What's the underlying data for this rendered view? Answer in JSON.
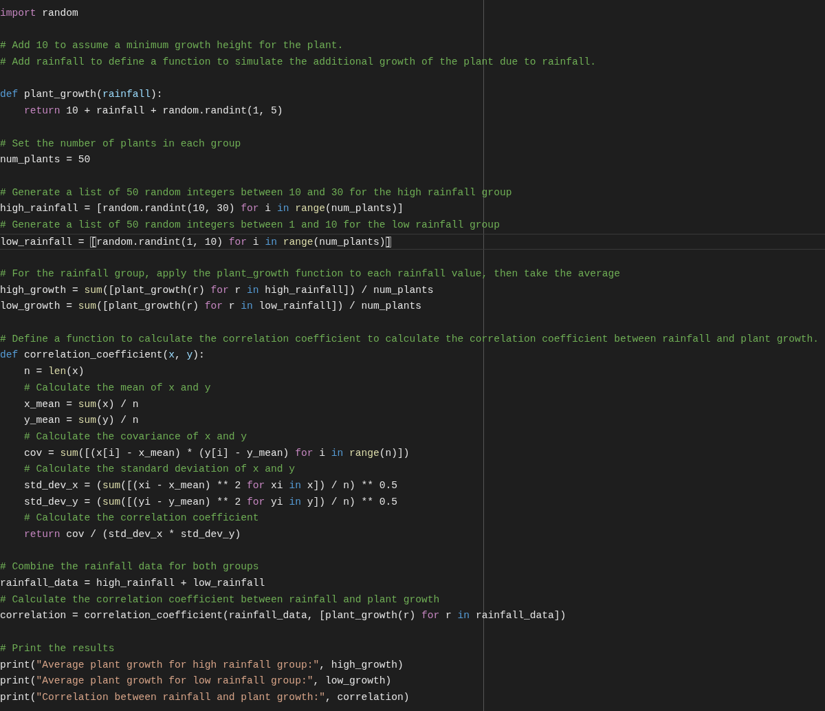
{
  "editor": {
    "lines": [
      {
        "tokens": [
          {
            "kind": "keyword",
            "text": "import"
          },
          {
            "kind": "plain",
            "text": " random"
          }
        ]
      },
      {
        "gap_before": true,
        "tokens": [
          {
            "kind": "comment",
            "text": "# Add 10 to assume a minimum growth height for the plant."
          }
        ]
      },
      {
        "tokens": [
          {
            "kind": "comment",
            "text": "# Add rainfall to define a function to simulate the additional growth of the plant due to rainfall."
          }
        ]
      },
      {
        "gap_before": true,
        "tokens": [
          {
            "kind": "storage",
            "text": "def"
          },
          {
            "kind": "plain",
            "text": " plant_growth("
          },
          {
            "kind": "param",
            "text": "rainfall"
          },
          {
            "kind": "plain",
            "text": "):"
          }
        ]
      },
      {
        "indented": true,
        "tokens": [
          {
            "kind": "keyword",
            "text": "return"
          },
          {
            "kind": "plain",
            "text": " 10 + rainfall + random.randint(1, 5)"
          }
        ]
      },
      {
        "gap_before": true,
        "tokens": [
          {
            "kind": "comment",
            "text": "# Set the number of plants in each group"
          }
        ]
      },
      {
        "tokens": [
          {
            "kind": "plain",
            "text": "num_plants = 50"
          }
        ]
      },
      {
        "gap_before": true,
        "tokens": [
          {
            "kind": "comment",
            "text": "# Generate a list of 50 random integers between 10 and 30 for the high rainfall group"
          }
        ]
      },
      {
        "tokens": [
          {
            "kind": "plain",
            "text": "high_rainfall = [random.randint(10, 30) "
          },
          {
            "kind": "keyword",
            "text": "for"
          },
          {
            "kind": "plain",
            "text": " i "
          },
          {
            "kind": "storage",
            "text": "in"
          },
          {
            "kind": "builtin",
            "text": " range"
          },
          {
            "kind": "plain",
            "text": "(num_plants)]"
          }
        ]
      },
      {
        "tokens": [
          {
            "kind": "comment",
            "text": "# Generate a list of 50 random integers between 1 and 10 for the low rainfall group"
          }
        ]
      },
      {
        "current": true,
        "tokens": [
          {
            "kind": "plain",
            "text": "low_rainfall = "
          },
          {
            "kind": "bracket",
            "text": "["
          },
          {
            "kind": "plain",
            "text": "random.randint(1, 10) "
          },
          {
            "kind": "keyword",
            "text": "for"
          },
          {
            "kind": "plain",
            "text": " i "
          },
          {
            "kind": "storage",
            "text": "in"
          },
          {
            "kind": "builtin",
            "text": " range"
          },
          {
            "kind": "plain",
            "text": "(num_plants)"
          },
          {
            "kind": "bracket",
            "text": "]"
          }
        ]
      },
      {
        "gap_before": true,
        "tokens": [
          {
            "kind": "comment",
            "text": "# For the rainfall group, apply the plant_growth function to each rainfall value, then take the average"
          }
        ]
      },
      {
        "tokens": [
          {
            "kind": "plain",
            "text": "high_growth = "
          },
          {
            "kind": "builtin",
            "text": "sum"
          },
          {
            "kind": "plain",
            "text": "([plant_growth(r) "
          },
          {
            "kind": "keyword",
            "text": "for"
          },
          {
            "kind": "plain",
            "text": " r "
          },
          {
            "kind": "storage",
            "text": "in"
          },
          {
            "kind": "plain",
            "text": " high_rainfall]) / num_plants"
          }
        ]
      },
      {
        "tokens": [
          {
            "kind": "plain",
            "text": "low_growth = "
          },
          {
            "kind": "builtin",
            "text": "sum"
          },
          {
            "kind": "plain",
            "text": "([plant_growth(r) "
          },
          {
            "kind": "keyword",
            "text": "for"
          },
          {
            "kind": "plain",
            "text": " r "
          },
          {
            "kind": "storage",
            "text": "in"
          },
          {
            "kind": "plain",
            "text": " low_rainfall]) / num_plants"
          }
        ]
      },
      {
        "gap_before": true,
        "tokens": [
          {
            "kind": "comment",
            "text": "# Define a function to calculate the correlation coefficient to calculate the correlation coefficient between rainfall and plant growth."
          }
        ]
      },
      {
        "tokens": [
          {
            "kind": "storage",
            "text": "def"
          },
          {
            "kind": "plain",
            "text": " correlation_coefficient("
          },
          {
            "kind": "param",
            "text": "x"
          },
          {
            "kind": "plain",
            "text": ", "
          },
          {
            "kind": "param",
            "text": "y"
          },
          {
            "kind": "plain",
            "text": "):"
          }
        ]
      },
      {
        "indented": true,
        "tokens": [
          {
            "kind": "plain",
            "text": "n = "
          },
          {
            "kind": "builtin",
            "text": "len"
          },
          {
            "kind": "plain",
            "text": "(x)"
          }
        ]
      },
      {
        "indented": true,
        "tokens": [
          {
            "kind": "comment",
            "text": "# Calculate the mean of x and y"
          }
        ]
      },
      {
        "indented": true,
        "tokens": [
          {
            "kind": "plain",
            "text": "x_mean = "
          },
          {
            "kind": "builtin",
            "text": "sum"
          },
          {
            "kind": "plain",
            "text": "(x) / n"
          }
        ]
      },
      {
        "indented": true,
        "tokens": [
          {
            "kind": "plain",
            "text": "y_mean = "
          },
          {
            "kind": "builtin",
            "text": "sum"
          },
          {
            "kind": "plain",
            "text": "(y) / n"
          }
        ]
      },
      {
        "indented": true,
        "tokens": [
          {
            "kind": "comment",
            "text": "# Calculate the covariance of x and y"
          }
        ]
      },
      {
        "indented": true,
        "tokens": [
          {
            "kind": "plain",
            "text": "cov = "
          },
          {
            "kind": "builtin",
            "text": "sum"
          },
          {
            "kind": "plain",
            "text": "([(x[i] - x_mean) * (y[i] - y_mean) "
          },
          {
            "kind": "keyword",
            "text": "for"
          },
          {
            "kind": "plain",
            "text": " i "
          },
          {
            "kind": "storage",
            "text": "in"
          },
          {
            "kind": "builtin",
            "text": " range"
          },
          {
            "kind": "plain",
            "text": "(n)])"
          }
        ]
      },
      {
        "indented": true,
        "tokens": [
          {
            "kind": "comment",
            "text": "# Calculate the standard deviation of x and y"
          }
        ]
      },
      {
        "indented": true,
        "tokens": [
          {
            "kind": "plain",
            "text": "std_dev_x = ("
          },
          {
            "kind": "builtin",
            "text": "sum"
          },
          {
            "kind": "plain",
            "text": "([(xi - x_mean) ** 2 "
          },
          {
            "kind": "keyword",
            "text": "for"
          },
          {
            "kind": "plain",
            "text": " xi "
          },
          {
            "kind": "storage",
            "text": "in"
          },
          {
            "kind": "plain",
            "text": " x]) / n) ** 0.5"
          }
        ]
      },
      {
        "indented": true,
        "tokens": [
          {
            "kind": "plain",
            "text": "std_dev_y = ("
          },
          {
            "kind": "builtin",
            "text": "sum"
          },
          {
            "kind": "plain",
            "text": "([(yi - y_mean) ** 2 "
          },
          {
            "kind": "keyword",
            "text": "for"
          },
          {
            "kind": "plain",
            "text": " yi "
          },
          {
            "kind": "storage",
            "text": "in"
          },
          {
            "kind": "plain",
            "text": " y]) / n) ** 0.5"
          }
        ]
      },
      {
        "indented": true,
        "tokens": [
          {
            "kind": "comment",
            "text": "# Calculate the correlation coefficient"
          }
        ]
      },
      {
        "indented": true,
        "tokens": [
          {
            "kind": "keyword",
            "text": "return"
          },
          {
            "kind": "plain",
            "text": " cov / (std_dev_x * std_dev_y)"
          }
        ]
      },
      {
        "gap_before": true,
        "tokens": [
          {
            "kind": "comment",
            "text": "# Combine the rainfall data for both groups"
          }
        ]
      },
      {
        "tokens": [
          {
            "kind": "plain",
            "text": "rainfall_data = high_rainfall + low_rainfall"
          }
        ]
      },
      {
        "tokens": [
          {
            "kind": "comment",
            "text": "# Calculate the correlation coefficient between rainfall and plant growth"
          }
        ]
      },
      {
        "tokens": [
          {
            "kind": "plain",
            "text": "correlation = correlation_coefficient(rainfall_data, [plant_growth(r) "
          },
          {
            "kind": "keyword",
            "text": "for"
          },
          {
            "kind": "plain",
            "text": " r "
          },
          {
            "kind": "storage",
            "text": "in"
          },
          {
            "kind": "plain",
            "text": " rainfall_data])"
          }
        ]
      },
      {
        "gap_before": true,
        "tokens": [
          {
            "kind": "comment",
            "text": "# Print the results"
          }
        ]
      },
      {
        "tokens": [
          {
            "kind": "plain",
            "text": "print("
          },
          {
            "kind": "string",
            "text": "\"Average plant growth for high rainfall group:\""
          },
          {
            "kind": "plain",
            "text": ", high_growth)"
          }
        ]
      },
      {
        "tokens": [
          {
            "kind": "plain",
            "text": "print("
          },
          {
            "kind": "string",
            "text": "\"Average plant growth for low rainfall group:\""
          },
          {
            "kind": "plain",
            "text": ", low_growth)"
          }
        ]
      },
      {
        "tokens": [
          {
            "kind": "plain",
            "text": "print("
          },
          {
            "kind": "string",
            "text": "\"Correlation between rainfall and plant growth:\""
          },
          {
            "kind": "plain",
            "text": ", correlation)"
          }
        ]
      }
    ]
  }
}
